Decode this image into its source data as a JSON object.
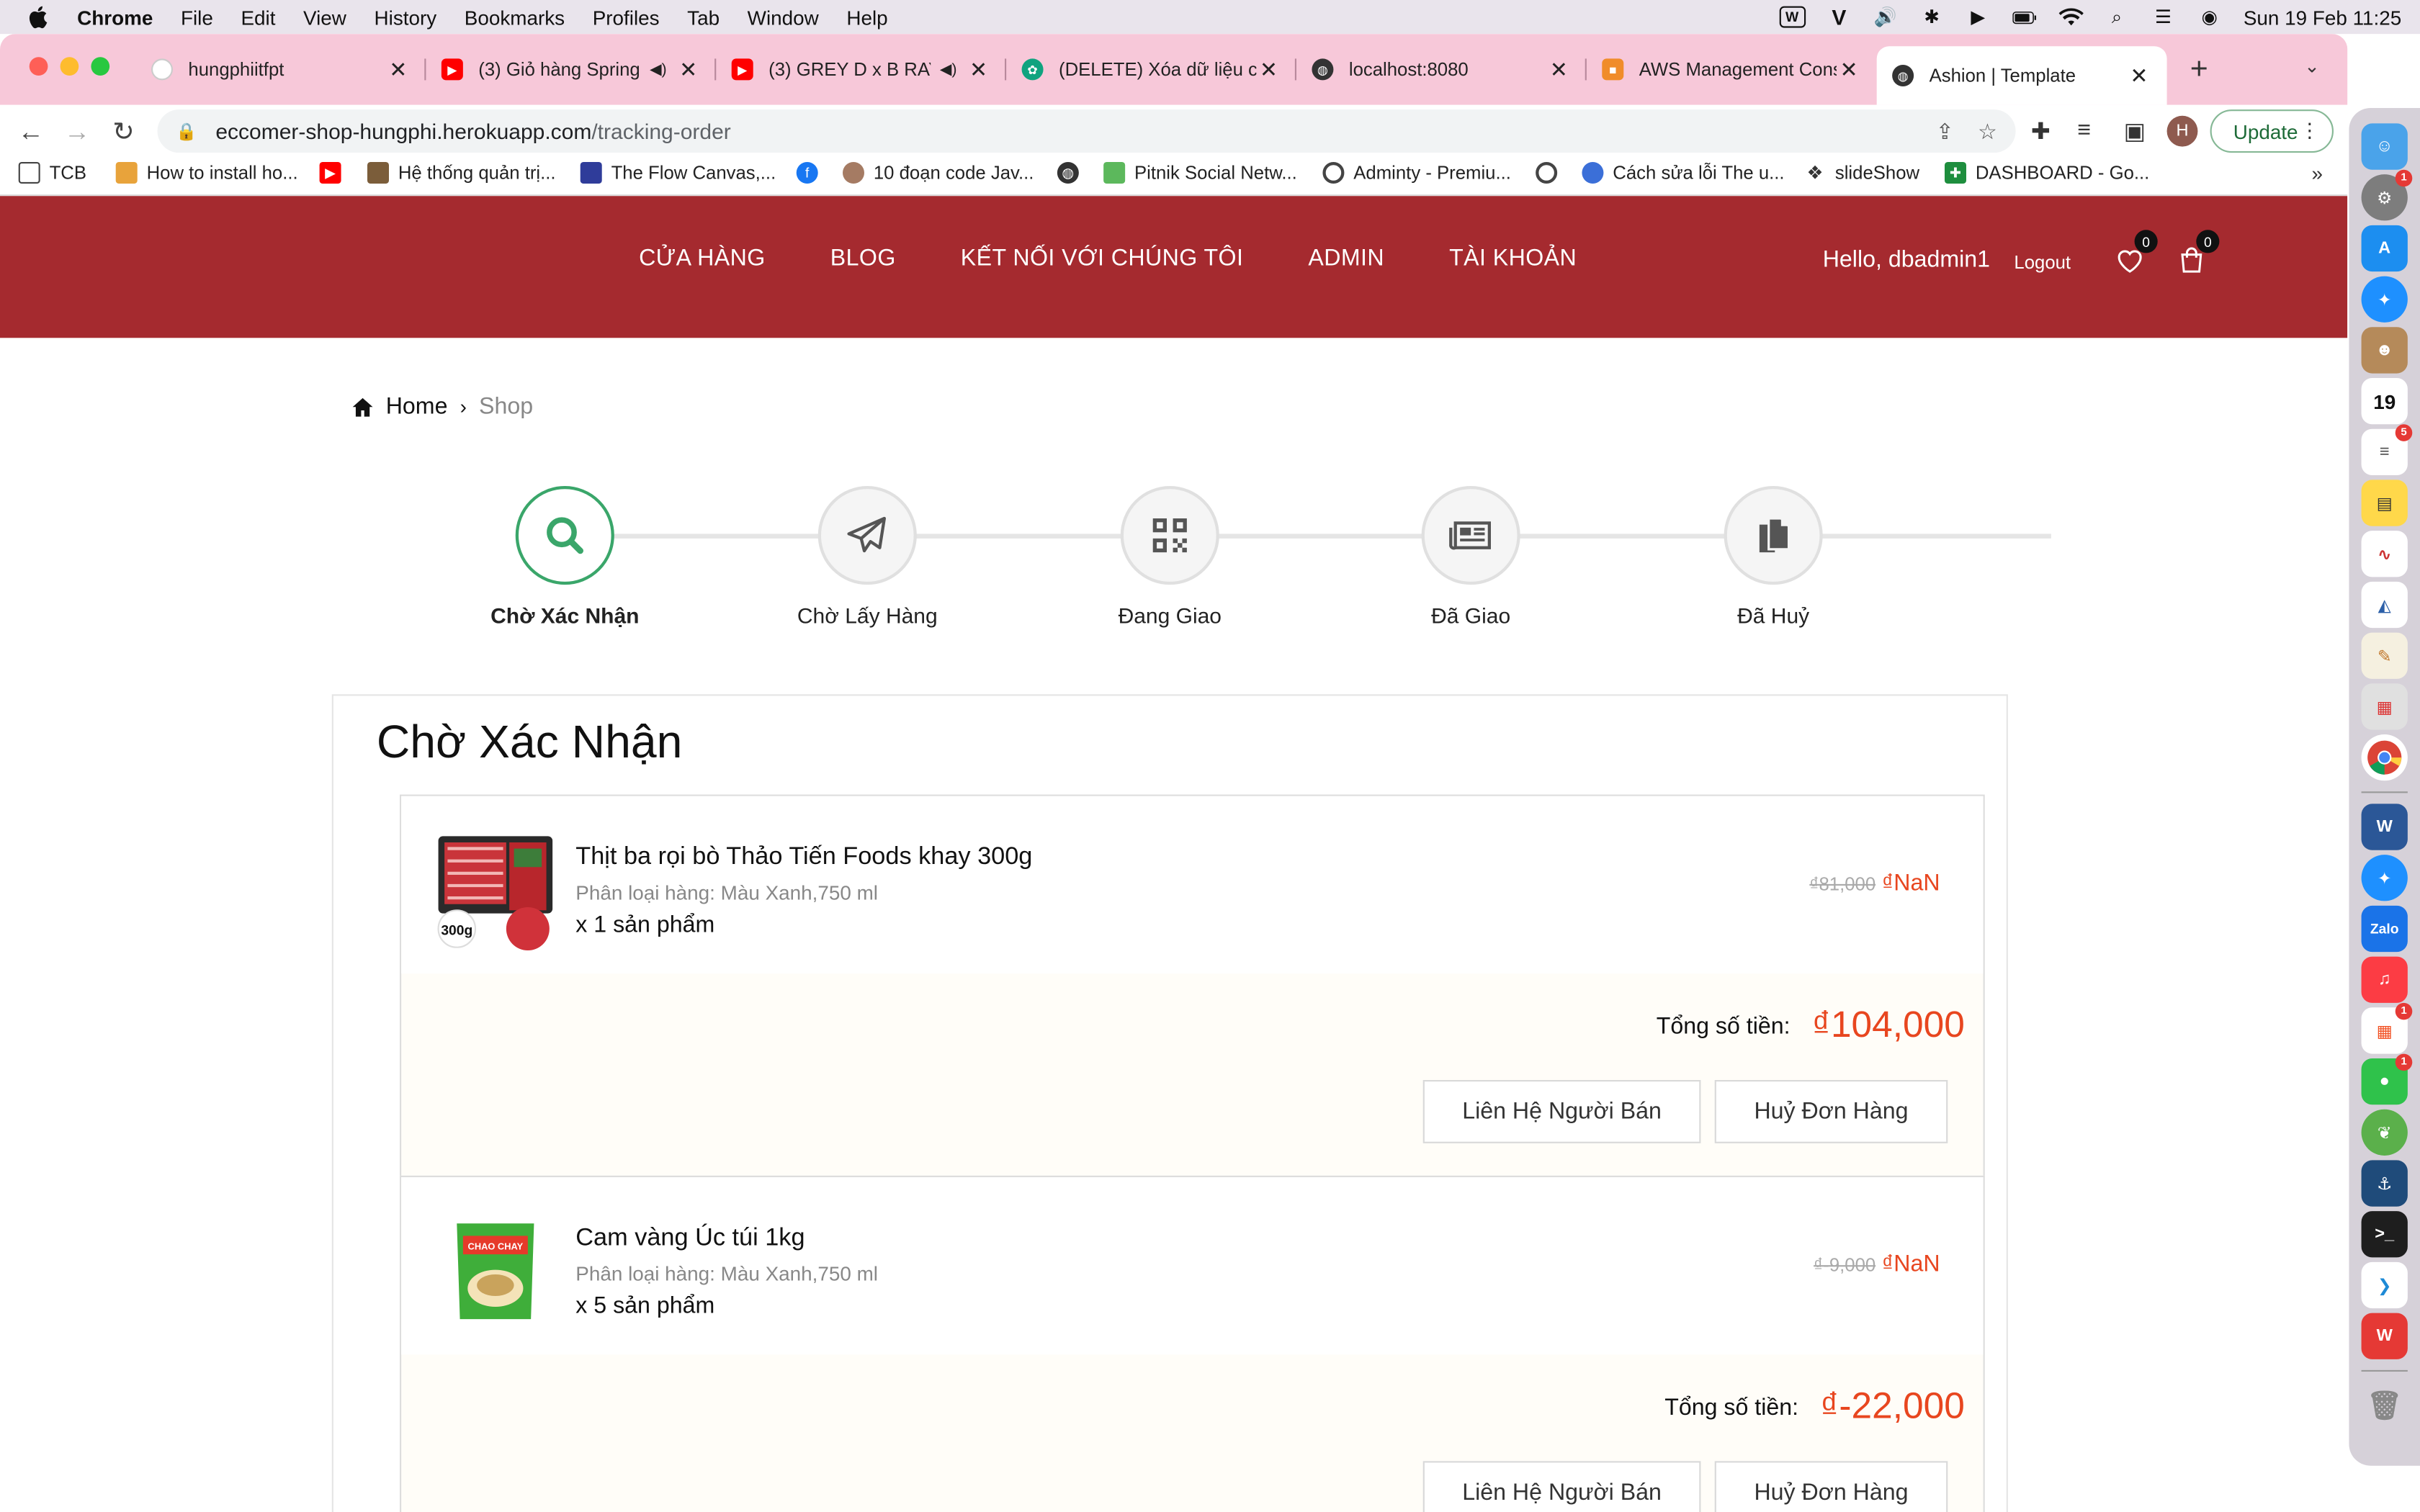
{
  "menubar": {
    "items": [
      "Chrome",
      "File",
      "Edit",
      "View",
      "History",
      "Bookmarks",
      "Profiles",
      "Tab",
      "Window",
      "Help"
    ],
    "clock": "Sun 19 Feb  11:25"
  },
  "tabs": [
    {
      "title": "hungphiitfpt",
      "favicon": "github-icon",
      "color": "#ffffff"
    },
    {
      "title": "(3) Giỏ hàng Spring",
      "favicon": "youtube-icon",
      "color": "#ff0000"
    },
    {
      "title": "(3) GREY D x B RAY",
      "favicon": "youtube-icon",
      "color": "#ff0000"
    },
    {
      "title": "(DELETE) Xóa dữ liệu củ",
      "favicon": "openai-icon",
      "color": "#10a37f"
    },
    {
      "title": "localhost:8080",
      "favicon": "globe-icon",
      "color": "#333333"
    },
    {
      "title": "AWS Management Cons",
      "favicon": "aws-icon",
      "color": "#f08c2a"
    },
    {
      "title": "Ashion | Template",
      "favicon": "globe-icon",
      "color": "#333333"
    }
  ],
  "url": {
    "host": "eccomer-shop-hungphi.herokuapp.com",
    "path": "/tracking-order"
  },
  "toolbar": {
    "update_label": "Update",
    "profile_initial": "H"
  },
  "bookmarks": [
    {
      "label": "TCB",
      "icon": "folder-icon"
    },
    {
      "label": "How to install ho...",
      "icon": "bookmark-icon"
    },
    {
      "label": "",
      "icon": "youtube-icon"
    },
    {
      "label": "Hệ thống quản trị...",
      "icon": "bookmark-icon"
    },
    {
      "label": "The Flow Canvas,...",
      "icon": "bookmark-icon"
    },
    {
      "label": "",
      "icon": "facebook-icon"
    },
    {
      "label": "10 đoạn code Jav...",
      "icon": "bookmark-icon"
    },
    {
      "label": "",
      "icon": "globe-icon"
    },
    {
      "label": "Pitnik Social Netw...",
      "icon": "bookmark-icon"
    },
    {
      "label": "Adminty - Premiu...",
      "icon": "bookmark-icon"
    },
    {
      "label": "",
      "icon": "bookmark-icon"
    },
    {
      "label": "Cách sửa lỗi The u...",
      "icon": "bookmark-icon"
    },
    {
      "label": "slideShow",
      "icon": "bookmark-icon"
    },
    {
      "label": "DASHBOARD - Go...",
      "icon": "sheets-icon"
    }
  ],
  "site": {
    "nav": [
      "CỬA HÀNG",
      "BLOG",
      "KẾT NỐI VỚI CHÚNG TÔI",
      "ADMIN",
      "TÀI KHOẢN"
    ],
    "hello": "Hello, dbadmin1",
    "logout": "Logout",
    "wishlist_count": "0",
    "cart_count": "0"
  },
  "breadcrumb": {
    "home": "Home",
    "current": "Shop"
  },
  "steps": [
    {
      "label": "Chờ Xác Nhận",
      "icon": "search-icon",
      "active": true
    },
    {
      "label": "Chờ Lấy Hàng",
      "icon": "paper-plane-icon",
      "active": false
    },
    {
      "label": "Đang Giao",
      "icon": "qrcode-icon",
      "active": false
    },
    {
      "label": "Đã Giao",
      "icon": "newspaper-icon",
      "active": false
    },
    {
      "label": "Đã Huỷ",
      "icon": "file-icon",
      "active": false
    }
  ],
  "orders": {
    "title": "Chờ Xác Nhận",
    "items": [
      {
        "name": "Thịt ba rọi bò Thảo Tiến Foods khay 300g",
        "variant": "Phân loại hàng: Màu Xanh,750 ml",
        "qty": "x 1 sản phẩm",
        "old_price": "₫81,000",
        "new_price": "₫NaN",
        "total_label": "Tổng số tiền:",
        "total": "₫104,000",
        "thumb_text": "300g",
        "contact_label": "Liên Hệ Người Bán",
        "cancel_label": "Huỷ Đơn Hàng"
      },
      {
        "name": "Cam vàng Úc túi 1kg",
        "variant": "Phân loại hàng: Màu Xanh,750 ml",
        "qty": "x 5 sản phẩm",
        "old_price": "₫-9,000",
        "new_price": "₫NaN",
        "total_label": "Tổng số tiền:",
        "total": "₫-22,000",
        "thumb_text": "CHAO CHAY",
        "contact_label": "Liên Hệ Người Bán",
        "cancel_label": "Huỷ Đơn Hàng"
      }
    ]
  },
  "colors": {
    "header": "#a52a2f",
    "accent_price": "#e8461f",
    "active_step": "#3aa66a",
    "tabbar": "#f7c8d9"
  },
  "dock": {
    "calendar_day": "19"
  }
}
